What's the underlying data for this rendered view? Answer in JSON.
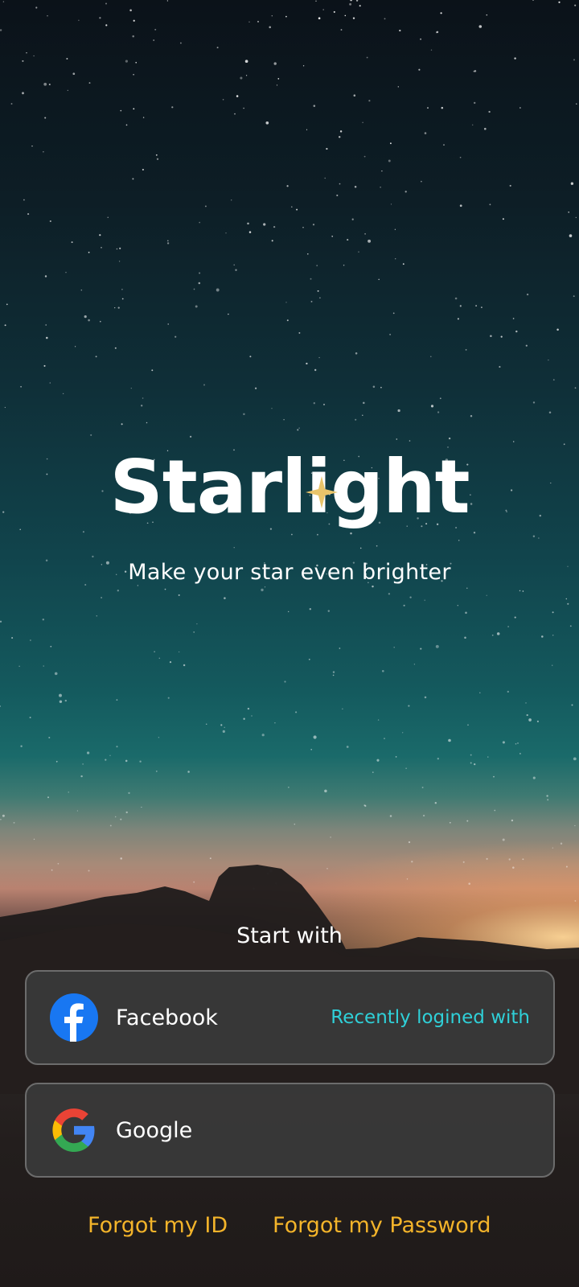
{
  "app": {
    "name": "Starlight",
    "tagline": "Make your star even brighter"
  },
  "login": {
    "heading": "Start with",
    "providers": [
      {
        "label": "Facebook",
        "icon": "facebook-icon",
        "note": "Recently logined with"
      },
      {
        "label": "Google",
        "icon": "google-icon"
      }
    ]
  },
  "links": {
    "forgot_id": "Forgot my ID",
    "forgot_password": "Forgot my Password"
  },
  "colors": {
    "accent_link": "#f3b42a",
    "recent_note": "#2fd0d8",
    "facebook_blue": "#1877f2",
    "logo_star": "#e9c46a"
  }
}
